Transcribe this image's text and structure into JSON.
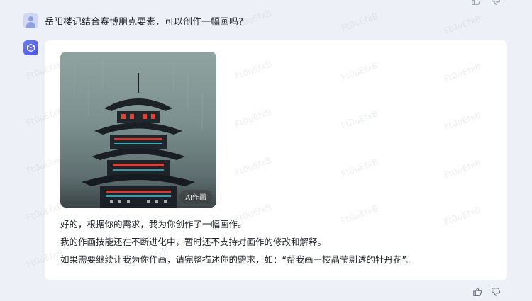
{
  "conversation": {
    "user_message": "岳阳楼记结合赛博朋克要素，可以创作一幅画吗?",
    "bot_reply": {
      "image_tag": "AI作画",
      "paragraphs": [
        "好的，根据你的需求，我为你创作了一幅画作。",
        "我的作画技能还在不断进化中，暂时还不支持对画作的修改和解释。",
        "如果需要继续让我为你作画，请完整描述你的需求，如：“帮我画一枝晶莹剔透的牡丹花”。"
      ]
    }
  },
  "watermark_text": "Ft0uEfxB",
  "icons": {
    "user_avatar": "user-avatar-icon",
    "bot_avatar": "cube-icon",
    "like": "thumbs-up-icon",
    "dislike": "thumbs-down-icon"
  }
}
